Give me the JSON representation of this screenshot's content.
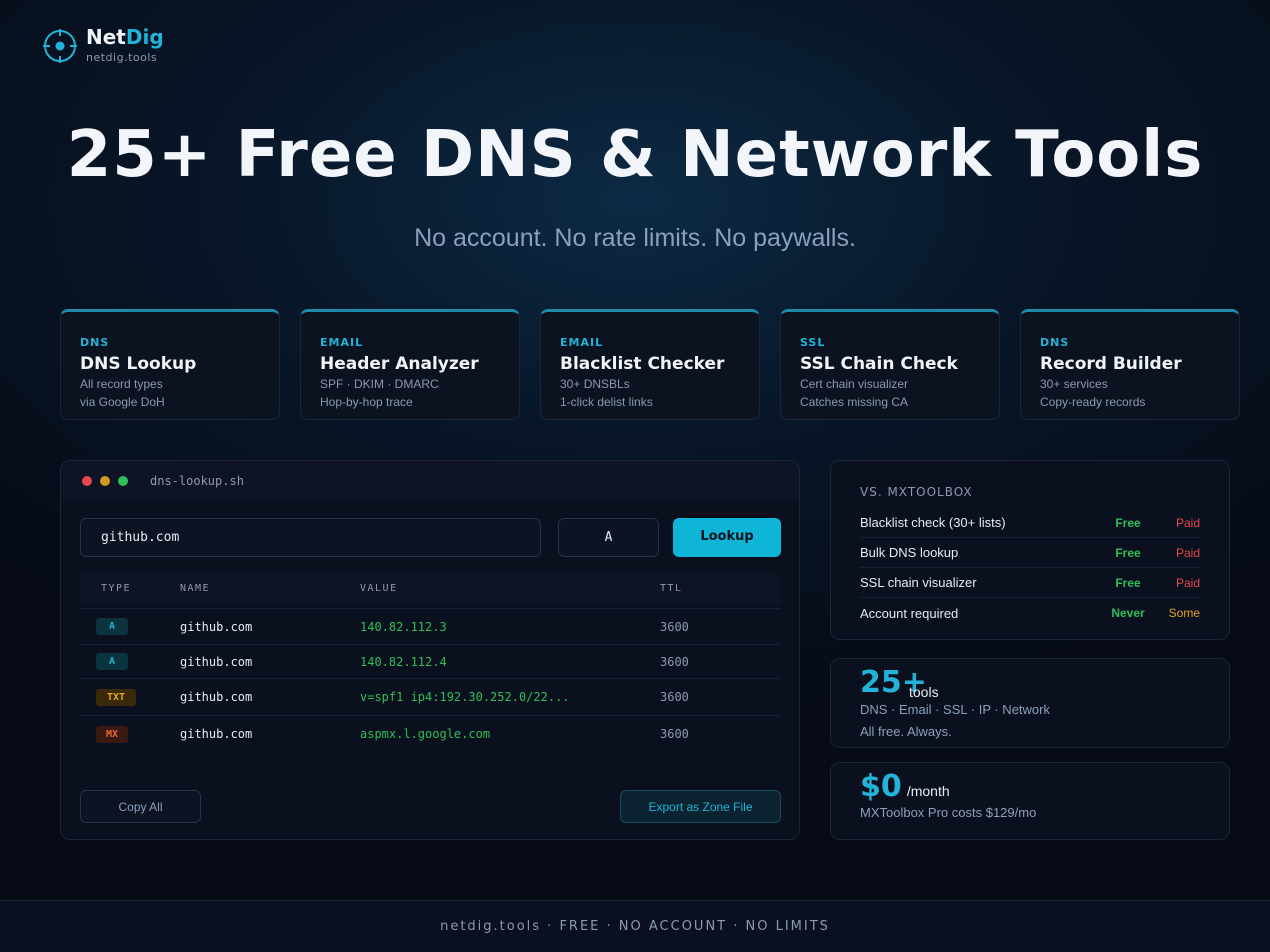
{
  "brand": {
    "name_main": "Net",
    "name_accent": "Dig",
    "domain": "netdig.tools",
    "accent_color": "#22b3d8"
  },
  "hero": {
    "title": "25+ Free DNS & Network Tools",
    "subtitle": "No account. No rate limits. No paywalls."
  },
  "cards": [
    {
      "tag": "DNS",
      "title": "DNS Lookup",
      "line1": "All record types",
      "line2": "via Google DoH"
    },
    {
      "tag": "EMAIL",
      "title": "Header Analyzer",
      "line1": "SPF · DKIM · DMARC",
      "line2": "Hop-by-hop trace"
    },
    {
      "tag": "EMAIL",
      "title": "Blacklist Checker",
      "line1": "30+ DNSBLs",
      "line2": "1-click delist links"
    },
    {
      "tag": "SSL",
      "title": "SSL Chain Check",
      "line1": "Cert chain visualizer",
      "line2": "Catches missing CA"
    },
    {
      "tag": "DNS",
      "title": "Record Builder",
      "line1": "30+ services",
      "line2": "Copy-ready records"
    }
  ],
  "terminal": {
    "filename": "dns-lookup.sh",
    "query_value": "github.com",
    "record_type": "A",
    "lookup_label": "Lookup",
    "columns": [
      "TYPE",
      "NAME",
      "VALUE",
      "TTL"
    ],
    "rows": [
      {
        "type": "A",
        "name": "github.com",
        "value": "140.82.112.3",
        "ttl": "3600"
      },
      {
        "type": "A",
        "name": "github.com",
        "value": "140.82.112.4",
        "ttl": "3600"
      },
      {
        "type": "TXT",
        "name": "github.com",
        "value": "v=spf1 ip4:192.30.252.0/22...",
        "ttl": "3600"
      },
      {
        "type": "MX",
        "name": "github.com",
        "value": "aspmx.l.google.com",
        "ttl": "3600"
      }
    ],
    "copy_label": "Copy All",
    "export_label": "Export as Zone File"
  },
  "comparison": {
    "title": "VS. MXTOOLBOX",
    "rows": [
      {
        "feature": "Blacklist check (30+ lists)",
        "ours": "Free",
        "theirs": "Paid"
      },
      {
        "feature": "Bulk DNS lookup",
        "ours": "Free",
        "theirs": "Paid"
      },
      {
        "feature": "SSL chain visualizer",
        "ours": "Free",
        "theirs": "Paid"
      },
      {
        "feature": "Account required",
        "ours": "Never",
        "theirs": "Some"
      }
    ]
  },
  "stat_tools": {
    "value": "25+",
    "unit": "tools",
    "line1": "DNS · Email · SSL · IP · Network",
    "line2": "All free. Always."
  },
  "stat_price": {
    "value": "$0",
    "unit": "/month",
    "line1": "MXToolbox Pro costs $129/mo"
  },
  "footer": {
    "text": "netdig.tools · FREE · NO ACCOUNT · NO LIMITS"
  }
}
